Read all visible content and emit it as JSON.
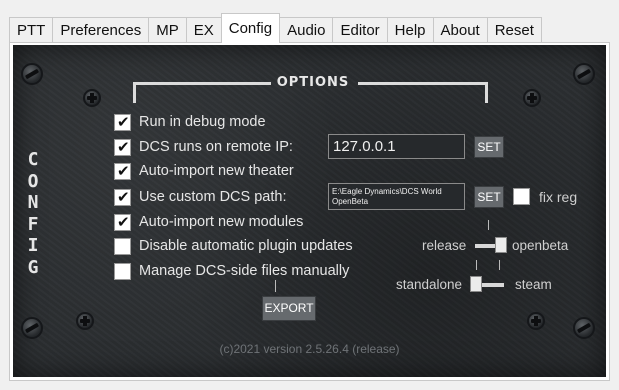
{
  "tabs": [
    {
      "label": "PTT"
    },
    {
      "label": "Preferences"
    },
    {
      "label": "MP"
    },
    {
      "label": "EX"
    },
    {
      "label": "Config",
      "active": true
    },
    {
      "label": "Audio"
    },
    {
      "label": "Editor"
    },
    {
      "label": "Help"
    },
    {
      "label": "About"
    },
    {
      "label": "Reset"
    }
  ],
  "panel": {
    "title": "OPTIONS",
    "side_text": "CONFIG",
    "version": "(c)2021 version 2.5.26.4 (release)"
  },
  "options": [
    {
      "label": "Run in debug mode",
      "checked": true
    },
    {
      "label": "DCS runs on remote IP:",
      "checked": true
    },
    {
      "label": "Auto-import new theater",
      "checked": true
    },
    {
      "label": "Use custom DCS path:",
      "checked": true
    },
    {
      "label": "Auto-import new modules",
      "checked": true
    },
    {
      "label": "Disable automatic plugin updates",
      "checked": false
    },
    {
      "label": "Manage DCS-side files manually",
      "checked": false
    }
  ],
  "remote_ip": {
    "value": "127.0.0.1",
    "set_label": "SET"
  },
  "custom_path": {
    "value_line1": "E:\\Eagle Dynamics\\DCS World",
    "value_line2": "OpenBeta",
    "set_label": "SET"
  },
  "fix_reg": {
    "label": "fix reg",
    "checked": false
  },
  "branch_switch": {
    "left": "release",
    "right": "openbeta",
    "selected": "openbeta"
  },
  "edition_switch": {
    "left": "standalone",
    "right": "steam",
    "selected": "standalone"
  },
  "export_label": "EXPORT",
  "colors": {
    "panel_bg": "#2b2e31",
    "button_bg": "#666a6e",
    "text": "#e6e6e6"
  }
}
